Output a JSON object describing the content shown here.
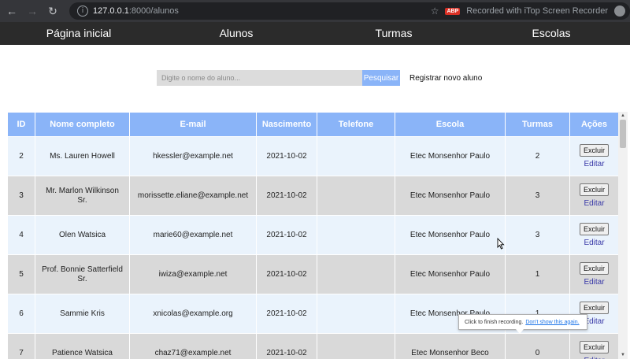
{
  "browser": {
    "url_host": "127.0.0.1",
    "url_rest": ":8000/alunos",
    "recording_text": "Recorded with iTop Screen Recorder",
    "abp_label": "ABP"
  },
  "nav": {
    "items": [
      "Página inicial",
      "Alunos",
      "Turmas",
      "Escolas"
    ]
  },
  "search": {
    "placeholder": "Digite o nome do aluno...",
    "button_label": "Pesquisar",
    "new_link": "Registrar novo aluno"
  },
  "table": {
    "headers": [
      "ID",
      "Nome completo",
      "E-mail",
      "Nascimento",
      "Telefone",
      "Escola",
      "Turmas",
      "Ações"
    ],
    "rows": [
      {
        "id": "2",
        "name": "Ms. Lauren Howell",
        "email": "hkessler@example.net",
        "birth": "2021-10-02",
        "phone": "",
        "school": "Etec Monsenhor Paulo",
        "classes": "2"
      },
      {
        "id": "3",
        "name": "Mr. Marlon Wilkinson Sr.",
        "email": "morissette.eliane@example.net",
        "birth": "2021-10-02",
        "phone": "",
        "school": "Etec Monsenhor Paulo",
        "classes": "3"
      },
      {
        "id": "4",
        "name": "Olen Watsica",
        "email": "marie60@example.net",
        "birth": "2021-10-02",
        "phone": "",
        "school": "Etec Monsenhor Paulo",
        "classes": "3"
      },
      {
        "id": "5",
        "name": "Prof. Bonnie Satterfield Sr.",
        "email": "iwiza@example.net",
        "birth": "2021-10-02",
        "phone": "",
        "school": "Etec Monsenhor Paulo",
        "classes": "1"
      },
      {
        "id": "6",
        "name": "Sammie Kris",
        "email": "xnicolas@example.org",
        "birth": "2021-10-02",
        "phone": "",
        "school": "Etec Monsenhor Paulo",
        "classes": "1"
      },
      {
        "id": "7",
        "name": "Patience Watsica",
        "email": "chaz71@example.net",
        "birth": "2021-10-02",
        "phone": "",
        "school": "Etec Monsenhor Beco",
        "classes": "0"
      }
    ],
    "delete_label": "Excluir",
    "edit_label": "Editar"
  },
  "tooltip": {
    "text": "Click to finish recording.",
    "link": "Don't show this again."
  }
}
